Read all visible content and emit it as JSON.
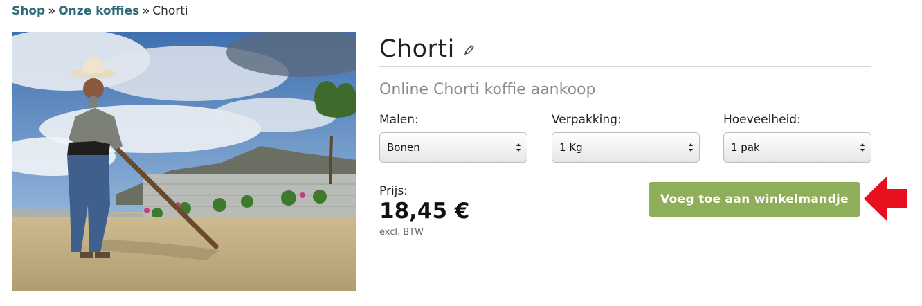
{
  "breadcrumb": {
    "shop": "Shop",
    "separator1": "»",
    "category": "Onze koffies",
    "separator2": "»",
    "current": "Chorti"
  },
  "product": {
    "title": "Chorti",
    "subtitle": "Online Chorti koffie aankoop",
    "image_icon": "farmer-raking-coffee-photo",
    "edit_icon": "pencil-icon"
  },
  "options": {
    "grind": {
      "label": "Malen:",
      "value": "Bonen"
    },
    "packaging": {
      "label": "Verpakking:",
      "value": "1 Kg"
    },
    "quantity": {
      "label": "Hoeveelheid:",
      "value": "1 pak"
    }
  },
  "price": {
    "label": "Prijs:",
    "amount": "18,45 €",
    "note": "excl. BTW"
  },
  "cart": {
    "button_label": "Voeg toe aan winkelmandje",
    "button_color": "#8fae59",
    "annotation_arrow_color": "#e8101f"
  },
  "colors": {
    "link": "#2e6b77"
  }
}
